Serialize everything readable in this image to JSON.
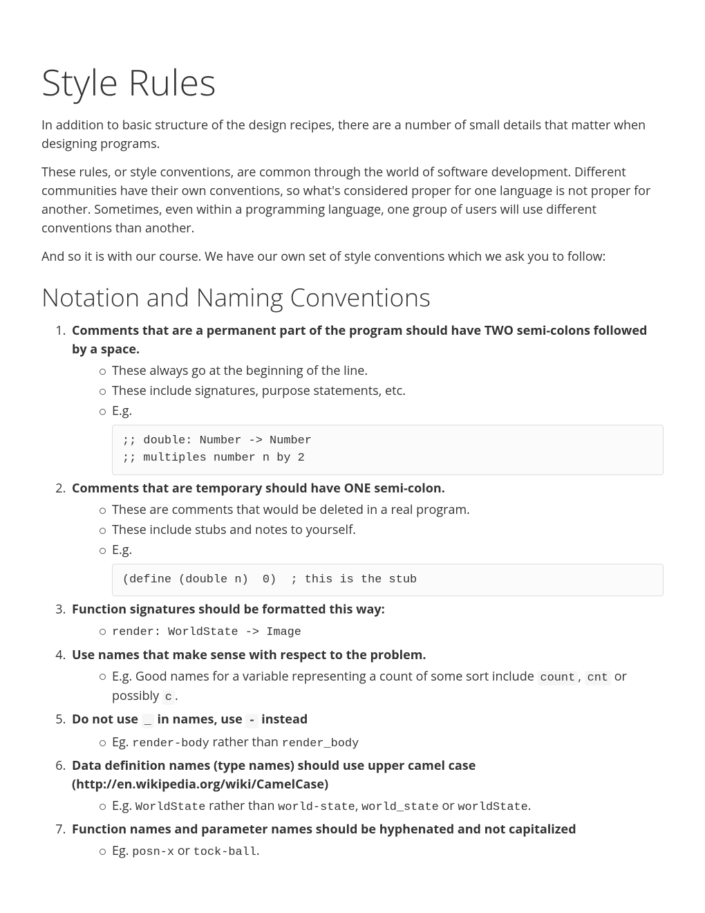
{
  "title": "Style Rules",
  "intro1": "In addition to basic structure of the design recipes, there are a number of small details that matter when designing programs.",
  "intro2": "These rules, or style conventions, are common through the world of software development. Different communities have their own conventions, so what's considered proper for one language is not proper for another. Sometimes, even within a programming language, one group of users will use different conventions than another.",
  "intro3": "And so it is with our course. We have our own set of style conventions which we ask you to follow:",
  "section1_title": "Notation and Naming Conventions",
  "rules": {
    "r1": {
      "head": "Comments that are a permanent part of the program should have TWO semi-colons followed by a space.",
      "b1": "These always go at the beginning of the line.",
      "b2": "These include signatures, purpose statements, etc.",
      "b3": "E.g.",
      "code": ";; double: Number -> Number\n;; multiples number n by 2"
    },
    "r2": {
      "head": "Comments that are temporary should have ONE semi-colon.",
      "b1": "These are comments that would be deleted in a real program.",
      "b2": "These include stubs and notes to yourself.",
      "b3": "E.g.",
      "code": "(define (double n)  0)  ; this is the stub"
    },
    "r3": {
      "head": "Function signatures should be formatted this way:",
      "b1": "render: WorldState -> Image"
    },
    "r4": {
      "head": "Use names that make sense with respect to the problem.",
      "b1_pre": "E.g. Good names for a variable representing a count of some sort include ",
      "b1_c1": "count",
      "b1_mid1": ", ",
      "b1_c2": "cnt",
      "b1_mid2": " or possibly ",
      "b1_c3": "c",
      "b1_post": "."
    },
    "r5": {
      "head_pre": "Do not use ",
      "head_c1": "_",
      "head_mid": " in names, use ",
      "head_c2": "-",
      "head_post": " instead",
      "b1_pre": "Eg. ",
      "b1_c1": "render-body",
      "b1_mid": " rather than ",
      "b1_c2": "render_body"
    },
    "r6": {
      "head_text": "Data definition names (type names) should use upper camel case (http://en.wikipedia.org/wiki/CamelCase)",
      "link_url": "http://en.wikipedia.org/wiki/CamelCase",
      "b1_pre": "E.g. ",
      "b1_c1": "WorldState",
      "b1_mid1": " rather than ",
      "b1_c2": "world-state",
      "b1_mid2": ", ",
      "b1_c3": "world_state",
      "b1_mid3": " or ",
      "b1_c4": "worldState",
      "b1_post": "."
    },
    "r7": {
      "head": "Function names and parameter names should be hyphenated and not capitalized",
      "b1_pre": "Eg. ",
      "b1_c1": "posn-x",
      "b1_mid": " or ",
      "b1_c2": "tock-ball",
      "b1_post": "."
    }
  }
}
